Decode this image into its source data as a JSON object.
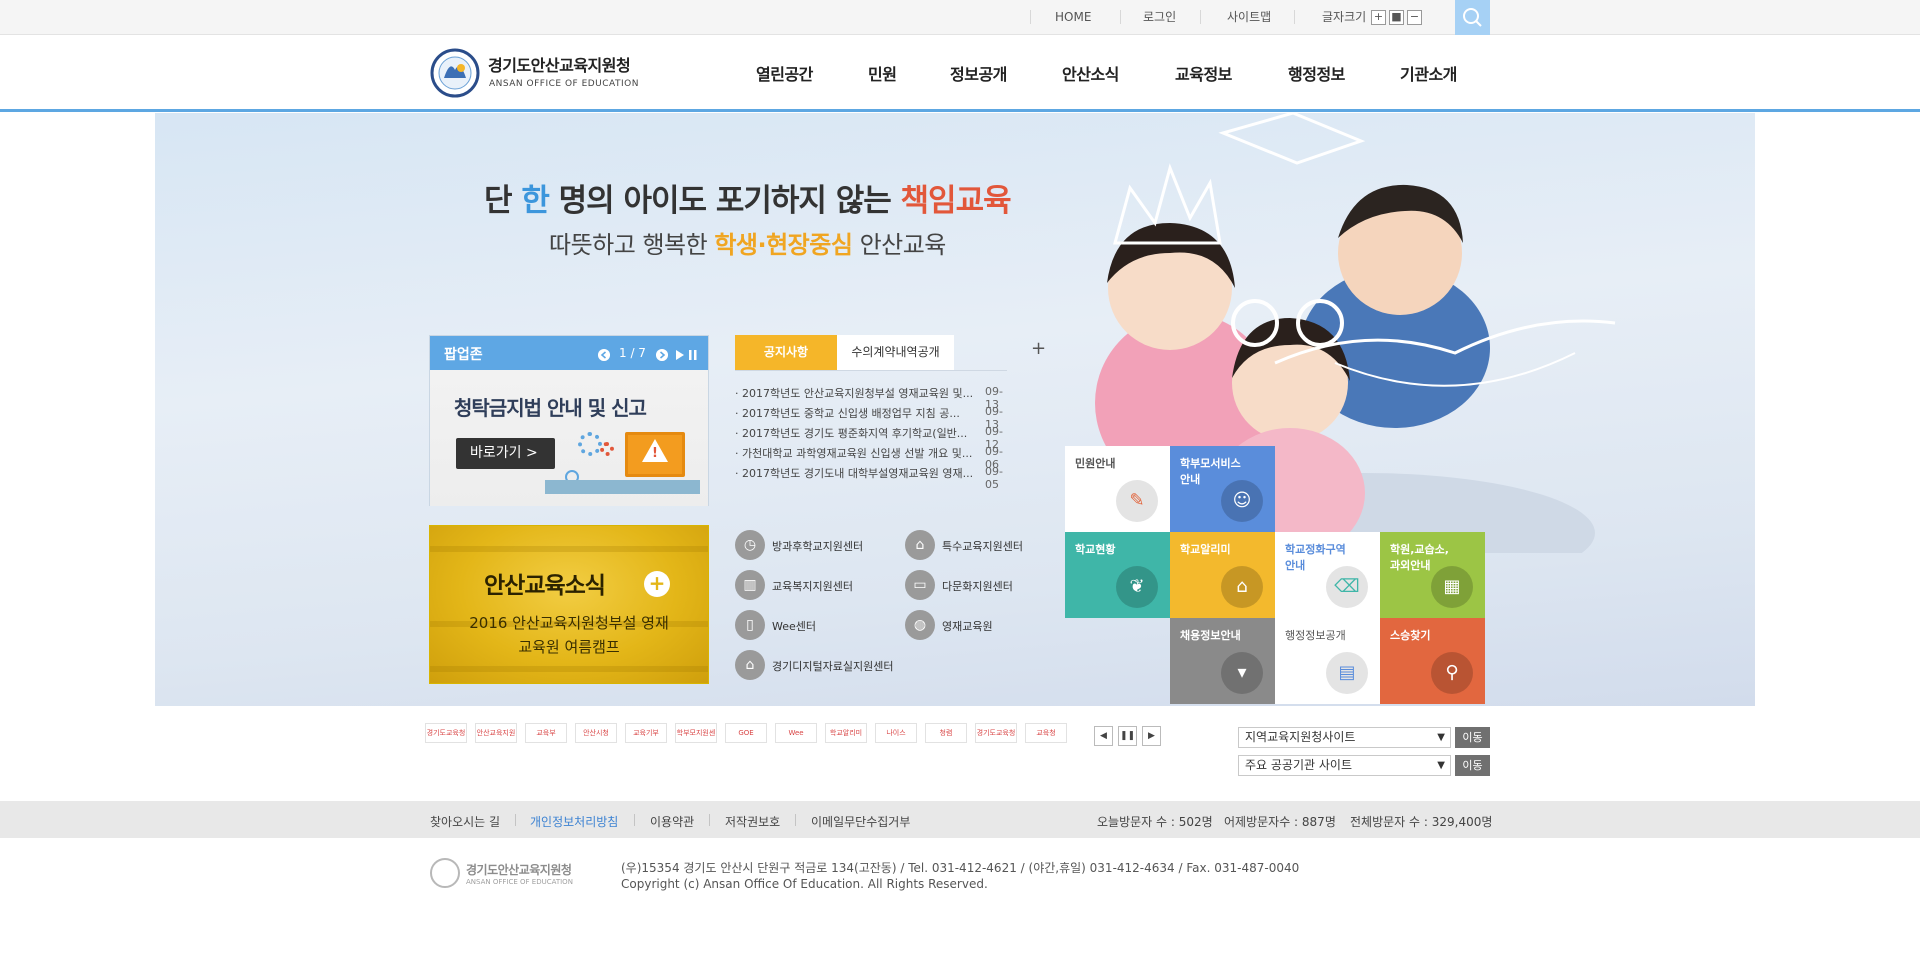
{
  "util": {
    "home": "HOME",
    "login": "로그인",
    "sitemap": "사이트맵",
    "font_size_label": "글자크기",
    "font_plus": "+",
    "font_reset": "■",
    "font_minus": "−"
  },
  "header": {
    "logo_kr": "경기도안산교육지원청",
    "logo_en": "ANSAN OFFICE OF EDUCATION",
    "menu": [
      "열린공간",
      "민원",
      "정보공개",
      "안산소식",
      "교육정보",
      "행정정보",
      "기관소개"
    ]
  },
  "visual": {
    "slogan1_a": "단 ",
    "slogan1_b": "한",
    "slogan1_c": " 명의 아이도 포기하지 않는 ",
    "slogan1_d": "책임교육",
    "slogan2_a": "따뜻하고 행복한 ",
    "slogan2_b": "학생·현장중심",
    "slogan2_c": " 안산교육"
  },
  "popup": {
    "title": "팝업존",
    "counter": "1 / 7",
    "main_text": "청탁금지법 안내 및 신고",
    "button": "바로가기  >"
  },
  "news": {
    "title": "안산교육소식",
    "plus": "+",
    "line1": "2016 안산교육지원청부설 영재",
    "line2": "교육원 여름캠프"
  },
  "board": {
    "tab_active": "공지사항",
    "tab_inactive": "수의계약내역공개",
    "more": "+",
    "items": [
      {
        "title": "· 2017학년도 안산교육지원청부설 영재교육원 및...",
        "date": "09-13"
      },
      {
        "title": "· 2017학년도 중학교 신입생 배정업무 지침 공...",
        "date": "09-13"
      },
      {
        "title": "· 2017학년도 경기도 평준화지역 후기학교(일반...",
        "date": "09-12"
      },
      {
        "title": "· 가천대학교 과학영재교육원 신입생 선발 개요 및...",
        "date": "09-06"
      },
      {
        "title": "· 2017학년도 경기도내 대학부설영재교육원 영재...",
        "date": "09-05"
      }
    ]
  },
  "quick_links": [
    {
      "label": "방과후학교지원센터",
      "icon": "clock-icon"
    },
    {
      "label": "특수교육지원센터",
      "icon": "house-icon"
    },
    {
      "label": "교육복지지원센터",
      "icon": "book-icon"
    },
    {
      "label": "다문화지원센터",
      "icon": "monitor-icon"
    },
    {
      "label": "Wee센터",
      "icon": "notebook-icon"
    },
    {
      "label": "영재교육원",
      "icon": "globe-icon"
    },
    {
      "label": "경기디지털자료실지원센터",
      "icon": "graduation-cap-icon"
    }
  ],
  "tiles": [
    {
      "label": "민원안내",
      "color": "#ffffff",
      "text_color": "#555555",
      "icon": "pencil-icon"
    },
    {
      "label": "학부모서비스\n안내",
      "color": "#5a8ddb",
      "text_color": "#ffffff",
      "icon": "parent-icon"
    },
    {
      "label": "학교현황",
      "color": "#3fb6a8",
      "text_color": "#ffffff",
      "icon": "sprout-icon"
    },
    {
      "label": "학교알리미",
      "color": "#f3b92d",
      "text_color": "#ffffff",
      "icon": "school-icon"
    },
    {
      "label": "학교정화구역\n안내",
      "color": "#ffffff",
      "text_color": "#5a8ddb",
      "icon": "broom-icon"
    },
    {
      "label": "학원,교습소,\n과외안내",
      "color": "#9cc545",
      "text_color": "#ffffff",
      "icon": "board-icon"
    },
    {
      "label": "채용정보안내",
      "color": "#8a8a8a",
      "text_color": "#ffffff",
      "icon": "tie-icon"
    },
    {
      "label": "행정정보공개",
      "color": "#ffffff",
      "text_color": "#555555",
      "icon": "chart-icon"
    },
    {
      "label": "스승찾기",
      "color": "#e2673f",
      "text_color": "#ffffff",
      "icon": "magnifier-icon"
    }
  ],
  "banners": [
    "경기도교육청",
    "안산교육지원청",
    "교육부",
    "안산시청",
    "교육기부",
    "학부모지원센터",
    "GOE",
    "Wee",
    "학교알리미",
    "나이스",
    "청렴",
    "경기도교육청",
    "교육청"
  ],
  "banner_controls": {
    "prev": "◀",
    "pause": "❚❚",
    "next": "▶"
  },
  "site_selects": [
    {
      "label": "지역교육지원청사이트",
      "go": "이동"
    },
    {
      "label": "주요 공공기관 사이트",
      "go": "이동"
    }
  ],
  "footer": {
    "links": [
      "찾아오시는 길",
      "개인정보처리방침",
      "이용약관",
      "저작권보호",
      "이메일무단수집거부"
    ],
    "visit_today": "오늘방문자 수 : 502명",
    "visit_yesterday": "어제방문자수 : 887명",
    "visit_total": "전체방문자 수 : 329,400명",
    "logo_kr": "경기도안산교육지원청",
    "logo_en": "ANSAN OFFICE OF EDUCATION",
    "address": "(우)15354 경기도 안산시 단원구 적금로 134(고잔동) / Tel. 031-412-4621 / (야간,휴일) 031-412-4634 / Fax. 031-487-0040",
    "copyright": "Copyright (c) Ansan Office Of Education. All Rights Reserved."
  },
  "colors": {
    "accent_blue": "#5ea7e4",
    "notice_orange": "#f5b629",
    "slogan_red": "#e2573a"
  }
}
